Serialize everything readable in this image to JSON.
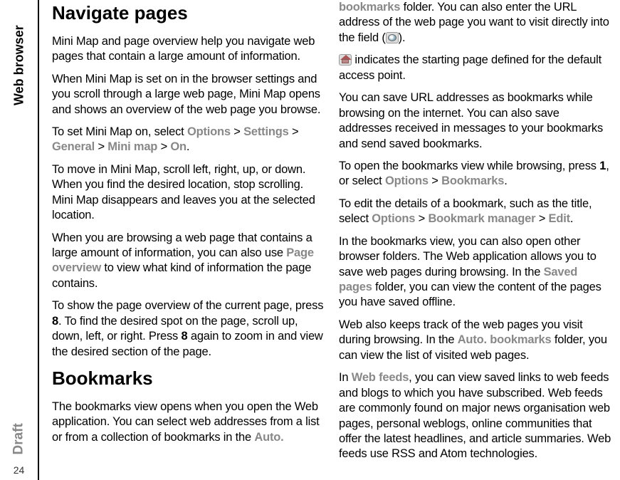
{
  "sidebar": {
    "section": "Web browser",
    "watermark": "Draft",
    "pageNumber": "24"
  },
  "left": {
    "h1": "Navigate pages",
    "p1": "Mini Map and page overview help you navigate web pages that contain a large amount of information.",
    "p2": "When Mini Map is set on in the browser settings and you scroll through a large web page, Mini Map opens and shows an overview of the web page you browse.",
    "p3a": "To set Mini Map on, select ",
    "opt": "Options",
    "gt": " > ",
    "settings": "Settings",
    "general": "General",
    "minimap": "Mini map",
    "on": "On",
    "period": ".",
    "p4": "To move in Mini Map, scroll left, right, up, or down. When you find the desired location, stop scrolling. Mini Map disappears and leaves you at the selected location.",
    "p5a": "When you are browsing a web page that contains a large amount of information, you can also use ",
    "pageoverview": "Page overview",
    "p5b": " to view what kind of information the page contains.",
    "p6a": "To show the page overview of the current page, press ",
    "eight": "8",
    "p6b": ". To find the desired spot on the page, scroll up, down, left, or right. Press ",
    "p6c": " again to zoom in and view the desired section of the page.",
    "h2": "Bookmarks",
    "p7a": "The bookmarks view opens when you open the Web application. You can select web addresses from a list or from a collection of bookmarks in the ",
    "autobm": "Auto."
  },
  "right": {
    "p1a": "bookmarks",
    "p1b": " folder. You can also enter the URL address of the web page you want to visit directly into the field (",
    "p1c": ").",
    "p2": " indicates the starting page defined for the default access point.",
    "p3": "You can save URL addresses as bookmarks while browsing on the internet. You can also save addresses received in messages to your bookmarks and send saved bookmarks.",
    "p4a": "To open the bookmarks view while browsing, press ",
    "one": "1",
    "p4b": ", or select ",
    "opt": "Options",
    "gt": " > ",
    "bookmarks": "Bookmarks",
    "period": ".",
    "p5a": "To edit the details of a bookmark, such as the title, select ",
    "bmmgr": "Bookmark manager",
    "edit": "Edit",
    "p6a": "In the bookmarks view, you can also open other browser folders. The Web application allows you to save web pages during browsing. In the ",
    "savedpages": "Saved pages",
    "p6b": " folder, you can view the content of the pages you have saved offline.",
    "p7a": "Web also keeps track of the web pages you visit during browsing. In the ",
    "autobm": "Auto. bookmarks",
    "p7b": " folder, you can view the list of visited web pages.",
    "p8a": "In ",
    "webfeeds": "Web feeds",
    "p8b": ", you can view saved links to web feeds and blogs to which you have subscribed. Web feeds are commonly found on major news organisation web pages, personal weblogs, online communities that offer the latest headlines, and article summaries. Web feeds use RSS and Atom technologies."
  }
}
